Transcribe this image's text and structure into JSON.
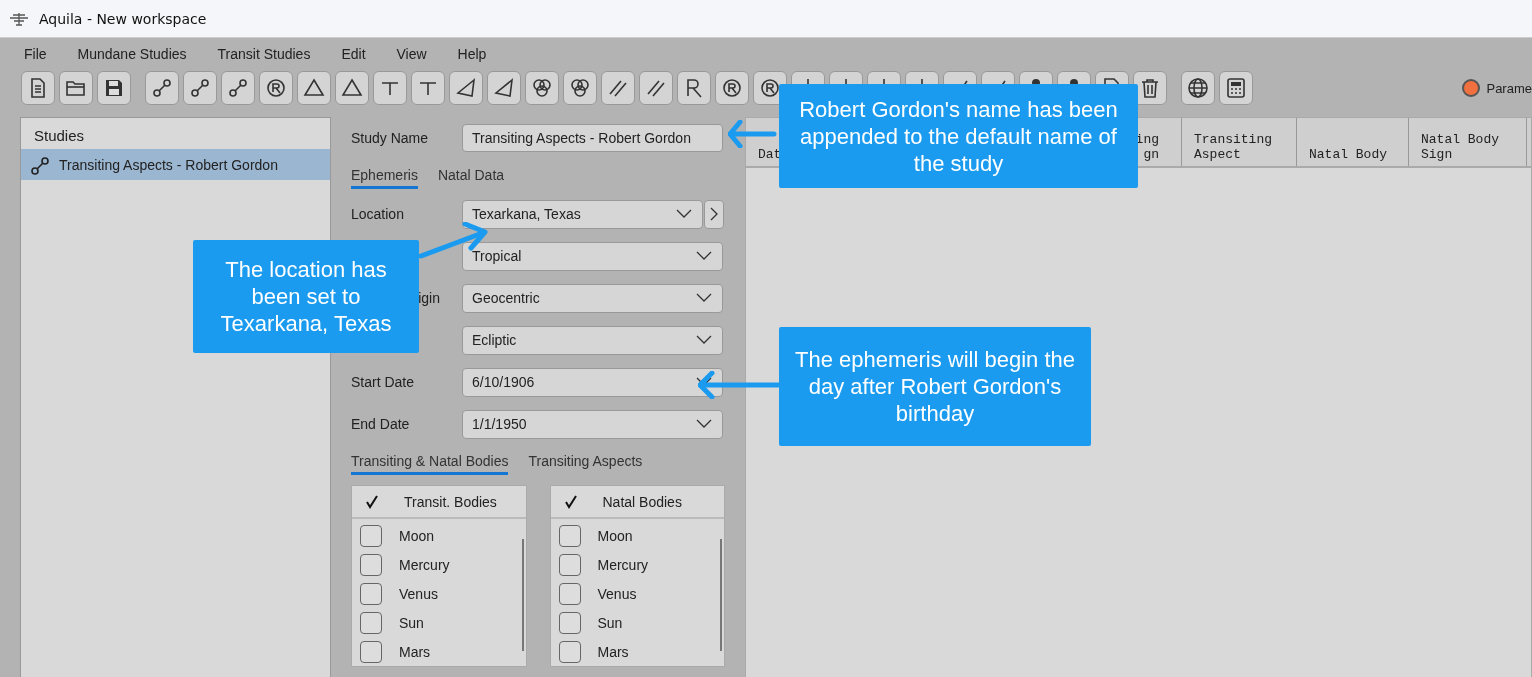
{
  "window": {
    "title": "Aquila - New workspace"
  },
  "menu": [
    "File",
    "Mundane Studies",
    "Transit Studies",
    "Edit",
    "View",
    "Help"
  ],
  "parameters_indicator": {
    "label": "Parame",
    "on": true
  },
  "studies": {
    "title": "Studies",
    "items": [
      {
        "label": "Transiting Aspects - Robert Gordon",
        "selected": true
      }
    ]
  },
  "study_form": {
    "name_label": "Study Name",
    "name_value": "Transiting Aspects - Robert Gordon",
    "tabs": [
      {
        "label": "Ephemeris",
        "selected": true
      },
      {
        "label": "Natal Data",
        "selected": false
      }
    ],
    "fields": [
      {
        "label": "Location",
        "value": "Texarkana, Texas",
        "next_button": true
      },
      {
        "value": "Tropical"
      },
      {
        "label": "igin",
        "label_partly_hidden": true,
        "value": "Geocentric"
      },
      {
        "value": "Ecliptic"
      },
      {
        "label": "Start Date",
        "value": "6/10/1906"
      },
      {
        "label": "End Date",
        "value": "1/1/1950"
      }
    ],
    "body_tabs": [
      {
        "label": "Transiting & Natal Bodies",
        "selected": true
      },
      {
        "label": "Transiting Aspects",
        "selected": false
      }
    ],
    "lists": [
      {
        "header": "Transit. Bodies",
        "all_checked": true,
        "items": [
          {
            "label": "Moon",
            "checked": false
          },
          {
            "label": "Mercury",
            "checked": false
          },
          {
            "label": "Venus",
            "checked": false
          },
          {
            "label": "Sun",
            "checked": false
          },
          {
            "label": "Mars",
            "checked": false
          }
        ]
      },
      {
        "header": "Natal Bodies",
        "all_checked": true,
        "items": [
          {
            "label": "Moon",
            "checked": false
          },
          {
            "label": "Mercury",
            "checked": false
          },
          {
            "label": "Venus",
            "checked": false
          },
          {
            "label": "Sun",
            "checked": false
          },
          {
            "label": "Mars",
            "checked": false
          }
        ]
      }
    ]
  },
  "table": {
    "columns": [
      [
        "Dat"
      ],
      [
        "ing",
        "gn"
      ],
      [
        "Transiting",
        "Aspect"
      ],
      [
        "Natal Body"
      ],
      [
        "Natal Body",
        "Sign"
      ]
    ]
  },
  "callouts": [
    {
      "text": "Robert Gordon's name has been appended to the default name of the study"
    },
    {
      "text": "The location has been set to Texarkana, Texas"
    },
    {
      "text": "The ephemeris will begin the day after Robert Gordon's birthday"
    }
  ]
}
